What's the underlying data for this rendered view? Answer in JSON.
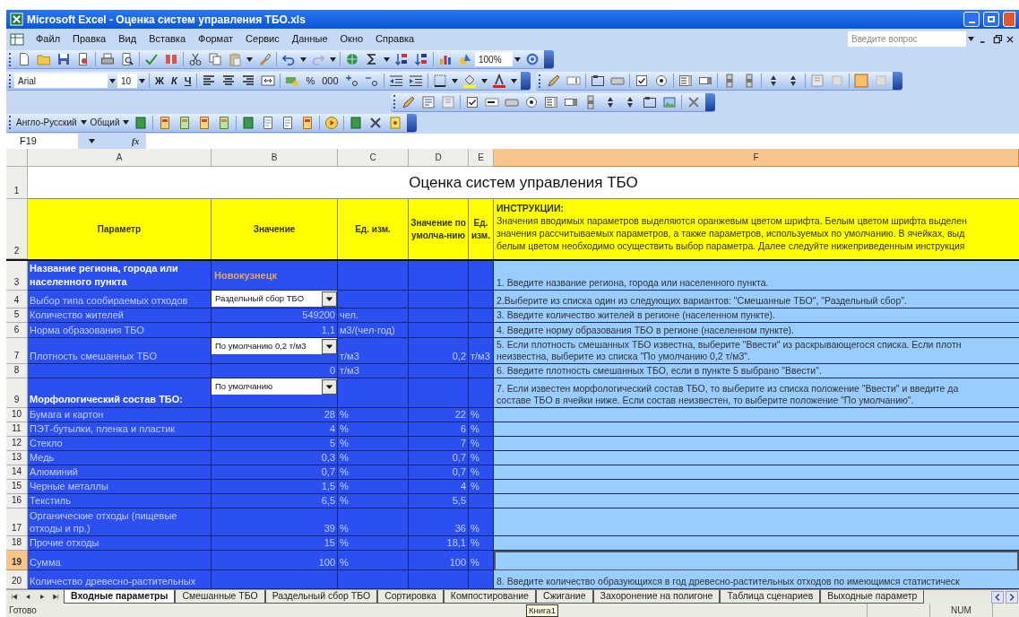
{
  "window": {
    "title": "Microsoft Excel - Оценка систем управления ТБО.xls"
  },
  "menu": [
    "Файл",
    "Правка",
    "Вид",
    "Вставка",
    "Формат",
    "Сервис",
    "Данные",
    "Окно",
    "Справка"
  ],
  "question_box": {
    "placeholder": "Введите вопрос"
  },
  "standard_toolbar": {
    "zoom": "100%"
  },
  "formatting_toolbar": {
    "font": "Arial",
    "size": "10",
    "bold": "Ж",
    "italic": "К",
    "underline": "Ч",
    "percent": "%",
    "thousands": "000"
  },
  "translation_toolbar": {
    "dictionary": "Англо-Русский",
    "topic": "Общий"
  },
  "formula_bar": {
    "name_box": "F19",
    "fx": "fx"
  },
  "sheet": {
    "columns": [
      {
        "label": "A",
        "selected": false
      },
      {
        "label": "B",
        "selected": false
      },
      {
        "label": "C",
        "selected": false
      },
      {
        "label": "D",
        "selected": false
      },
      {
        "label": "E",
        "selected": false
      },
      {
        "label": "F",
        "selected": true
      }
    ],
    "title": "Оценка систем управления ТБО",
    "header": {
      "row_1": "1",
      "row_2": "2",
      "parameter": "Параметр",
      "value": "Значение",
      "unit": "Ед. изм.",
      "default_value": "Значение по умолча-нию",
      "default_unit": "Ед. изм.",
      "instructions_heading": "ИНСТРУКЦИИ:",
      "instructions": [
        "Значения вводимых параметров выделяются оранжевым цветом шрифта. Белым цветом шрифта выделен",
        "значения рассчитываемых параметров, а также параметров, используемых по умолчанию. В ячейках, выд",
        "белым цветом необходимо осуществить выбор параметра. Далее следуйте нижеприведенным инструкция"
      ]
    },
    "rows": [
      {
        "number": "3",
        "selected": false,
        "kind": "section",
        "a": "Название региона, города или населенного пункта",
        "b": {
          "kind": "input",
          "text": "Новокузнецк"
        },
        "f": [
          "1. Введите название региона, города или населенного пункта."
        ]
      },
      {
        "number": "4",
        "selected": false,
        "kind": "item",
        "a": "Выбор типа сообираемых отходов",
        "b": {
          "kind": "dropdown",
          "text": "Раздельный сбор ТБО"
        },
        "f": [
          "2.Выберите из списка один из следующих вариантов: \"Смешанные ТБО\", \"Раздельный сбор\"."
        ]
      },
      {
        "number": "5",
        "selected": false,
        "kind": "item",
        "a": "Количество жителей",
        "b": {
          "kind": "value",
          "text": "549200"
        },
        "c": "чел.",
        "f": [
          "3. Введите количество жителей в регионе (населенном пункте)."
        ]
      },
      {
        "number": "6",
        "selected": false,
        "kind": "item",
        "a": "Норма образования ТБО",
        "b": {
          "kind": "value",
          "text": "1,1"
        },
        "c": "м3/(чел·год)",
        "f": [
          "4. Введите норму образования ТБО в регионе (населенном пункте)."
        ]
      },
      {
        "number": "7",
        "selected": false,
        "kind": "item",
        "a": "Плотность смешанных ТБО",
        "b": {
          "kind": "dropdown",
          "text": "По умолчанию 0,2 т/м3"
        },
        "c": "т/м3",
        "d": "0,2",
        "e": "т/м3",
        "f": [
          "5. Если плотность смешанных ТБО известна, выберите \"Ввести\" из раскрывающегося списка. Если плотн",
          "неизвестна, выберите из списка \"По умолчанию 0,2 т/м3\"."
        ]
      },
      {
        "number": "8",
        "selected": false,
        "kind": "item",
        "b": {
          "kind": "value",
          "text": "0"
        },
        "c": "т/м3",
        "f": [
          "6. Введите плотность смешанных ТБО, если в пункте 5 выбрано \"Ввести\"."
        ]
      },
      {
        "number": "9",
        "selected": false,
        "kind": "section",
        "a": "Морфологический состав ТБО:",
        "b": {
          "kind": "dropdown",
          "text": "По умолчанию"
        },
        "f": [
          "7.  Если известен морфологический состав ТБО, то выберите из  списка положение \"Ввести\" и введите да",
          "составе ТБО в ячейки ниже. Если состав неизвестен, то выберите положение \"По умолчанию\"."
        ]
      },
      {
        "number": "10",
        "selected": false,
        "kind": "item",
        "a": "Бумага и картон",
        "b": {
          "kind": "value",
          "text": "28"
        },
        "c": "%",
        "d": "22",
        "e": "%"
      },
      {
        "number": "11",
        "selected": false,
        "kind": "item",
        "a": "ПЭТ-бутылки, пленка и пластик",
        "b": {
          "kind": "value",
          "text": "4"
        },
        "c": "%",
        "d": "6",
        "e": "%"
      },
      {
        "number": "12",
        "selected": false,
        "kind": "item",
        "a": "Стекло",
        "b": {
          "kind": "value",
          "text": "5"
        },
        "c": "%",
        "d": "7",
        "e": "%"
      },
      {
        "number": "13",
        "selected": false,
        "kind": "item",
        "a": "Медь",
        "b": {
          "kind": "value",
          "text": "0,3"
        },
        "c": "%",
        "d": "0,7",
        "e": "%"
      },
      {
        "number": "14",
        "selected": false,
        "kind": "item",
        "a": "Алюминий",
        "b": {
          "kind": "value",
          "text": "0,7"
        },
        "c": "%",
        "d": "0,7",
        "e": "%"
      },
      {
        "number": "15",
        "selected": false,
        "kind": "item",
        "a": "Черные металлы",
        "b": {
          "kind": "value",
          "text": "1,5"
        },
        "c": "%",
        "d": "4",
        "e": "%"
      },
      {
        "number": "16",
        "selected": false,
        "kind": "item",
        "a": "Текстиль",
        "b": {
          "kind": "value",
          "text": "6,5"
        },
        "c": "%",
        "d": "5,5"
      },
      {
        "number": "17",
        "selected": false,
        "kind": "item",
        "a": "Органические отходы (пищевые отходы и пр.)",
        "b": {
          "kind": "value",
          "text": "39"
        },
        "c": "%",
        "d": "36",
        "e": "%"
      },
      {
        "number": "18",
        "selected": false,
        "kind": "item",
        "a": "Прочие отходы",
        "b": {
          "kind": "value",
          "text": "15"
        },
        "c": "%",
        "d": "18,1",
        "e": "%"
      },
      {
        "number": "19",
        "selected": true,
        "kind": "item",
        "a": "Сумма",
        "b": {
          "kind": "value",
          "text": "100"
        },
        "c": "%",
        "d": "100",
        "e": "%"
      },
      {
        "number": "20",
        "selected": false,
        "kind": "item",
        "a": "Количество древесно-растительных",
        "f": [
          "8. Введите количество образующихся в год древесно-растительных отходов по имеющимся статистическ"
        ]
      }
    ]
  },
  "sheet_tabs": [
    {
      "label": "Входные параметры",
      "selected": true
    },
    {
      "label": "Смешанные ТБО",
      "selected": false
    },
    {
      "label": "Раздельный сбор ТБО",
      "selected": false
    },
    {
      "label": "Сортировка",
      "selected": false
    },
    {
      "label": "Компостирование",
      "selected": false
    },
    {
      "label": "Сжигание",
      "selected": false
    },
    {
      "label": "Захоронение на полигоне",
      "selected": false
    },
    {
      "label": "Таблица сценариев",
      "selected": false
    },
    {
      "label": "Выходные параметр",
      "selected": false
    }
  ],
  "status_bar": {
    "text": "Готово",
    "tooltip": "Книга1",
    "indicator": "NUM"
  }
}
